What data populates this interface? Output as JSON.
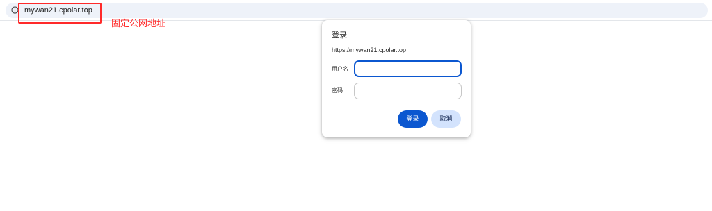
{
  "browser": {
    "url": "mywan21.cpolar.top",
    "annotation": "固定公网地址"
  },
  "dialog": {
    "title": "登录",
    "origin": "https://mywan21.cpolar.top",
    "username_label": "用户名",
    "username_value": "",
    "password_label": "密码",
    "password_value": "",
    "login_label": "登录",
    "cancel_label": "取消"
  },
  "colors": {
    "accent": "#0b57d0",
    "cancel_bg": "#d3e3fd",
    "annotation": "#ff2a2a"
  }
}
